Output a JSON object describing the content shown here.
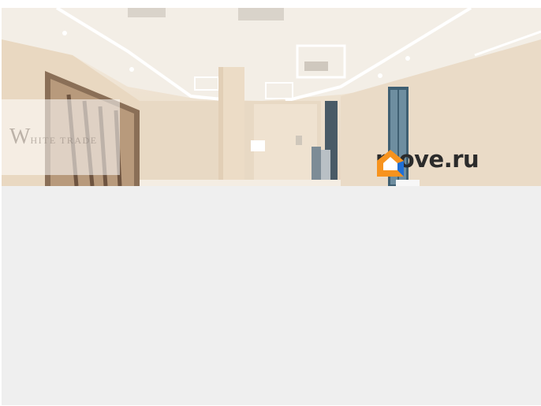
{
  "photo": {
    "watermark": {
      "initial": "W",
      "rest": "HITE TRADE"
    },
    "brand": {
      "name": "move.ru",
      "icon": "house-logo-icon",
      "icon_colors": [
        "#f7931e",
        "#1f6fd6"
      ]
    }
  }
}
